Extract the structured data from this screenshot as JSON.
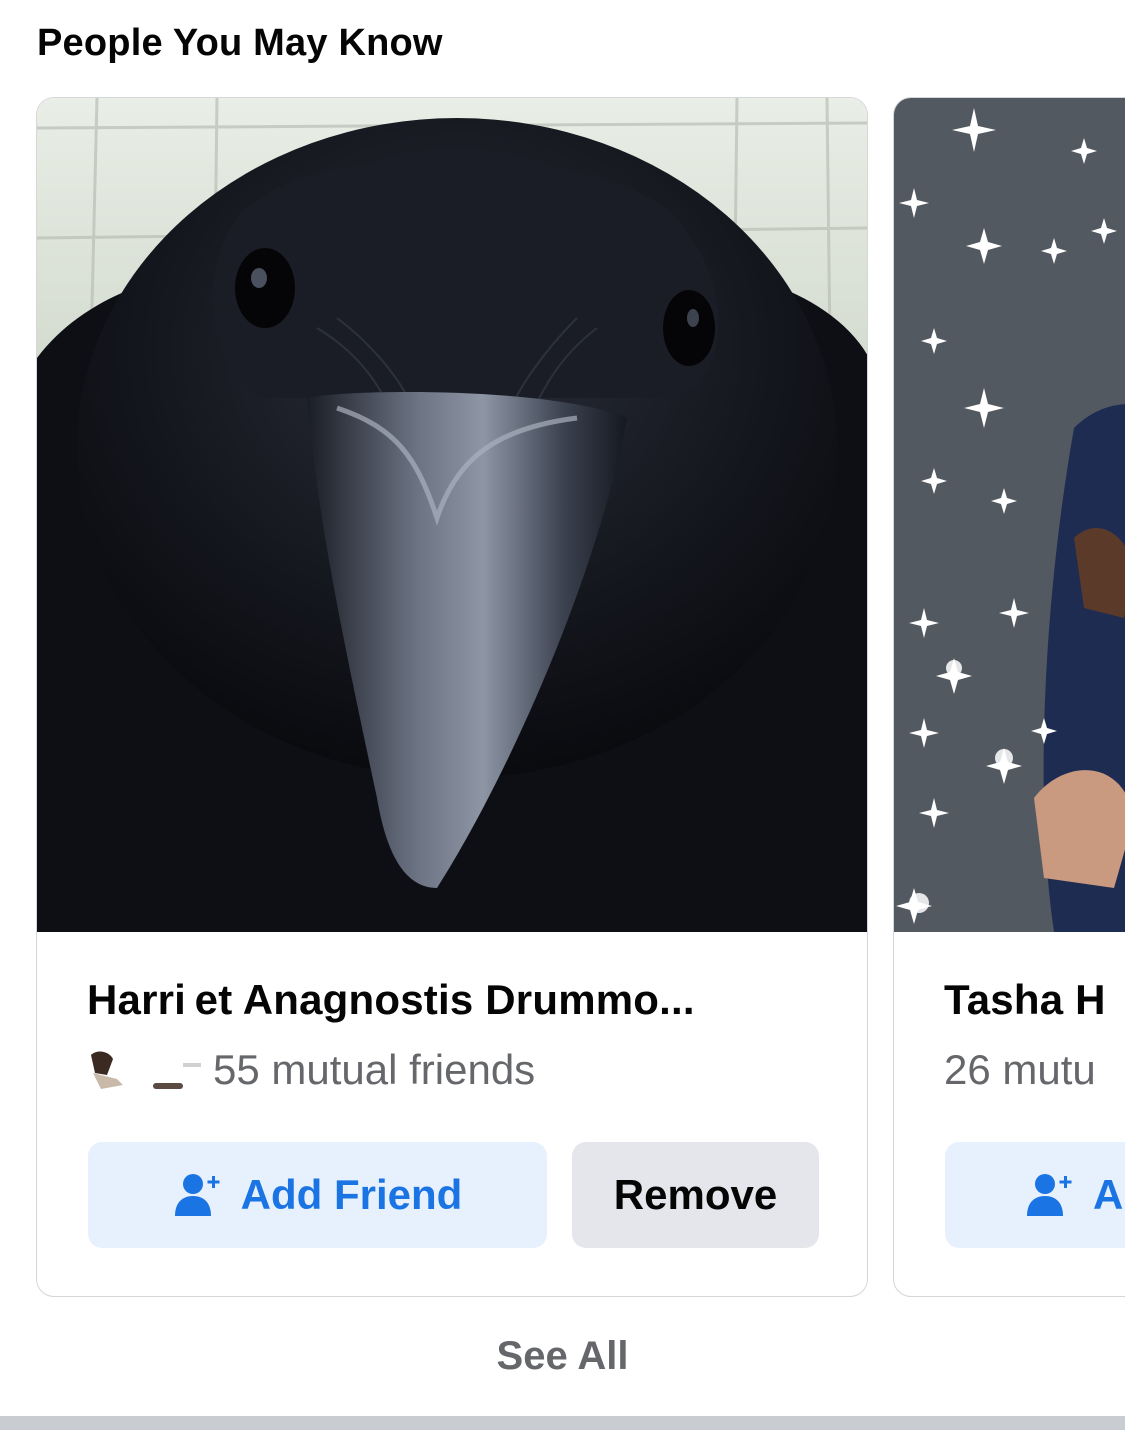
{
  "section": {
    "title": "People You May Know"
  },
  "cards": [
    {
      "name": "Harri et Anagnostis Drummo...",
      "mutual": "55 mutual friends",
      "add_label": "Add Friend",
      "remove_label": "Remove",
      "photo_subject": "raven close-up"
    },
    {
      "name": "Tasha H",
      "mutual": "26 mutu",
      "add_label": "A",
      "photo_subject": "sparkles background"
    }
  ],
  "footer": {
    "see_all_label": "See All"
  },
  "colors": {
    "accent": "#1b74e4",
    "add_bg": "#e7f0fd",
    "remove_bg": "#e4e6eb",
    "secondary_text": "#65676b"
  },
  "icons": {
    "add_friend": "add-friend-icon"
  }
}
